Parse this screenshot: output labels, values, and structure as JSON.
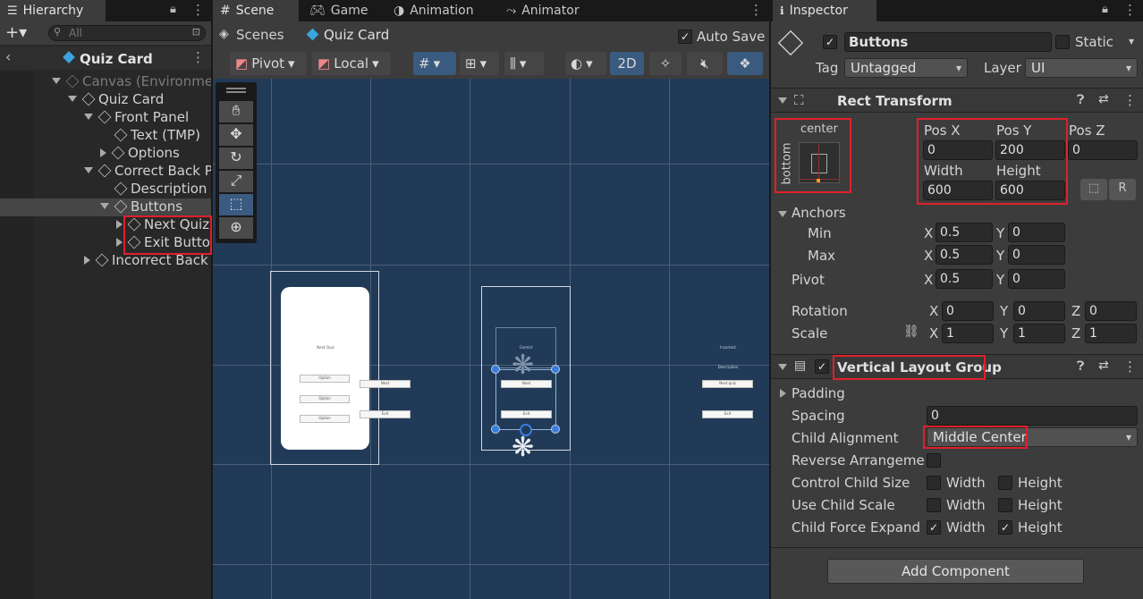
{
  "hierarchy": {
    "tab": "Hierarchy",
    "search_placeholder": "All",
    "scene_name": "Quiz Card",
    "items": [
      {
        "label": "Canvas (Environme",
        "depth": 0,
        "expanded": true,
        "dim": true
      },
      {
        "label": "Quiz Card",
        "depth": 1,
        "expanded": true
      },
      {
        "label": "Front Panel",
        "depth": 2,
        "expanded": true
      },
      {
        "label": "Text (TMP)",
        "depth": 3
      },
      {
        "label": "Options",
        "depth": 3,
        "expanded": false
      },
      {
        "label": "Correct Back P",
        "depth": 2,
        "expanded": true
      },
      {
        "label": "Description",
        "depth": 3
      },
      {
        "label": "Buttons",
        "depth": 3,
        "expanded": true,
        "selected": true
      },
      {
        "label": "Next Quiz",
        "depth": 4,
        "expanded": false
      },
      {
        "label": "Exit Butto",
        "depth": 4,
        "expanded": false
      },
      {
        "label": "Incorrect Back",
        "depth": 2,
        "expanded": false
      }
    ]
  },
  "scene": {
    "tabs": [
      "Scene",
      "Game",
      "Animation",
      "Animator"
    ],
    "breadcrumb": {
      "root": "Scenes",
      "current": "Quiz Card"
    },
    "auto_save_label": "Auto Save",
    "pivot_label": "Pivot",
    "local_label": "Local",
    "mode_2d": "2D",
    "preview": {
      "front_title": "Next Quiz",
      "front_opts": [
        "Option",
        "Option",
        "Option"
      ],
      "side_buttons": [
        "Next",
        "Exit"
      ],
      "mid_title": "Correct",
      "mid_title2": "",
      "mid_buttons": [
        "Next",
        "Exit"
      ],
      "right_title": "Incorrect",
      "right_title2": "Description",
      "right_buttons": [
        "Next quiz",
        "Exit"
      ]
    }
  },
  "inspector": {
    "tab": "Inspector",
    "object_name": "Buttons",
    "static_label": "Static",
    "tag_label": "Tag",
    "tag_value": "Untagged",
    "layer_label": "Layer",
    "layer_value": "UI",
    "rect_transform": {
      "title": "Rect Transform",
      "anchor_h": "center",
      "anchor_v": "bottom",
      "pos_x_label": "Pos X",
      "pos_x": "0",
      "pos_y_label": "Pos Y",
      "pos_y": "200",
      "pos_z_label": "Pos Z",
      "pos_z": "0",
      "width_label": "Width",
      "width": "600",
      "height_label": "Height",
      "height": "600",
      "anchors_label": "Anchors",
      "min_label": "Min",
      "min_x": "0.5",
      "min_y": "0",
      "max_label": "Max",
      "max_x": "0.5",
      "max_y": "0",
      "pivot_label": "Pivot",
      "pivot_x": "0.5",
      "pivot_y": "0",
      "rotation_label": "Rotation",
      "rot_x": "0",
      "rot_y": "0",
      "rot_z": "0",
      "scale_label": "Scale",
      "scale_x": "1",
      "scale_y": "1",
      "scale_z": "1",
      "x": "X",
      "y": "Y",
      "z": "Z"
    },
    "vlg": {
      "title": "Vertical Layout Group",
      "padding_label": "Padding",
      "spacing_label": "Spacing",
      "spacing": "0",
      "child_alignment_label": "Child Alignment",
      "child_alignment": "Middle Center",
      "reverse_label": "Reverse Arrangemen",
      "control_size_label": "Control Child Size",
      "use_scale_label": "Use Child Scale",
      "force_expand_label": "Child Force Expand",
      "width": "Width",
      "height": "Height"
    },
    "add_component": "Add Component"
  },
  "colors": {
    "accent_red": "#e0202b",
    "selection_blue": "#3a5a80",
    "scene_bg": "#213a57"
  }
}
